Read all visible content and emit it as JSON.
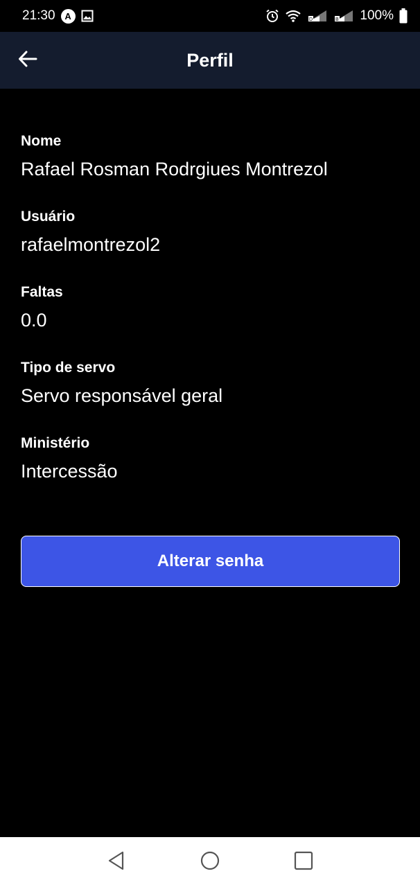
{
  "status_bar": {
    "time": "21:30",
    "battery": "100%",
    "icons": [
      "app-a-icon",
      "image-icon",
      "alarm-icon",
      "wifi-icon",
      "signal-icon",
      "signal-icon",
      "battery-icon"
    ]
  },
  "header": {
    "title": "Perfil",
    "back_icon": "arrow-left-icon",
    "background": "#141c2e"
  },
  "profile": {
    "fields": [
      {
        "label": "Nome",
        "value": "Rafael Rosman Rodrgiues Montrezol"
      },
      {
        "label": "Usuário",
        "value": "rafaelmontrezol2"
      },
      {
        "label": "Faltas",
        "value": "0.0"
      },
      {
        "label": "Tipo de servo",
        "value": "Servo responsável geral"
      },
      {
        "label": "Ministério",
        "value": "Intercessão"
      }
    ]
  },
  "actions": {
    "change_password_label": "Alterar senha",
    "button_color": "#3d55e6"
  },
  "nav_bar": {
    "icons": [
      "back-triangle-icon",
      "home-circle-icon",
      "recents-square-icon"
    ]
  }
}
